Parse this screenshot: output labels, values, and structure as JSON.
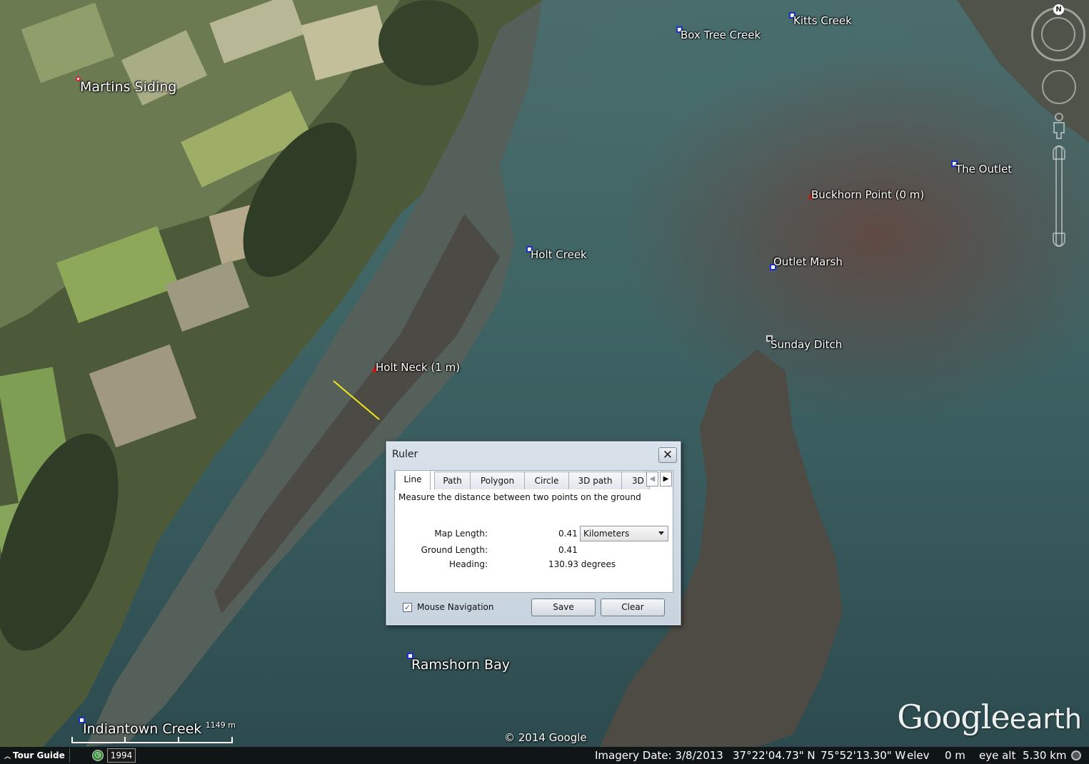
{
  "placemarks": [
    {
      "name": "Martins Siding",
      "size": "big",
      "pin": "dot"
    },
    {
      "name": "Box Tree Creek",
      "size": "small",
      "pin": "square"
    },
    {
      "name": "Kitts Creek",
      "size": "small",
      "pin": "square"
    },
    {
      "name": "The Outlet",
      "size": "small",
      "pin": "square"
    },
    {
      "name": "Buckhorn Point (0 m)",
      "size": "small",
      "pin": "flag"
    },
    {
      "name": "Holt Creek",
      "size": "small",
      "pin": "square"
    },
    {
      "name": "Outlet Marsh",
      "size": "small",
      "pin": "square"
    },
    {
      "name": "Sunday Ditch",
      "size": "small",
      "pin": "square-white"
    },
    {
      "name": "Holt Neck (1 m)",
      "size": "small",
      "pin": "flag"
    },
    {
      "name": "Ramshorn Bay",
      "size": "big",
      "pin": "square"
    },
    {
      "name": "Indiantown Creek",
      "size": "big",
      "pin": "square"
    }
  ],
  "nav": {
    "compass_letter": "N",
    "icons": [
      "compass-ring-icon",
      "look-joystick-icon",
      "street-view-person-icon",
      "zoom-slider-icon"
    ]
  },
  "ruler": {
    "title": "Ruler",
    "close_glyph": "✕",
    "tabs": [
      "Line",
      "Path",
      "Polygon",
      "Circle",
      "3D path",
      "3D"
    ],
    "active_tab": "Line",
    "description": "Measure the distance between two points on the ground",
    "map_length_label": "Map Length:",
    "map_length_value": "0.41",
    "units": "Kilometers",
    "ground_length_label": "Ground Length:",
    "ground_length_value": "0.41",
    "heading_label": "Heading:",
    "heading_value": "130.93 degrees",
    "mouse_navigation_label": "Mouse Navigation",
    "mouse_navigation_checked": true,
    "save_label": "Save",
    "clear_label": "Clear"
  },
  "scale_bar": {
    "label": "1149 m"
  },
  "copyright": "© 2014 Google",
  "logo": {
    "word1": "Google",
    "word2": "earth"
  },
  "status_bar": {
    "tour_guide": "Tour Guide",
    "year": "1994",
    "imagery_date": "Imagery Date: 3/8/2013",
    "latitude": "37°22'04.73\" N",
    "longitude": "75°52'13.30\" W",
    "elev_label": "elev",
    "elev_value": "0 m",
    "eye_alt_label": "eye alt",
    "eye_alt_value": "5.30 km"
  },
  "colors": {
    "measure_line": "#f2e81a",
    "pin_blue": "#1a2fd0",
    "pin_red": "#c41d12"
  }
}
